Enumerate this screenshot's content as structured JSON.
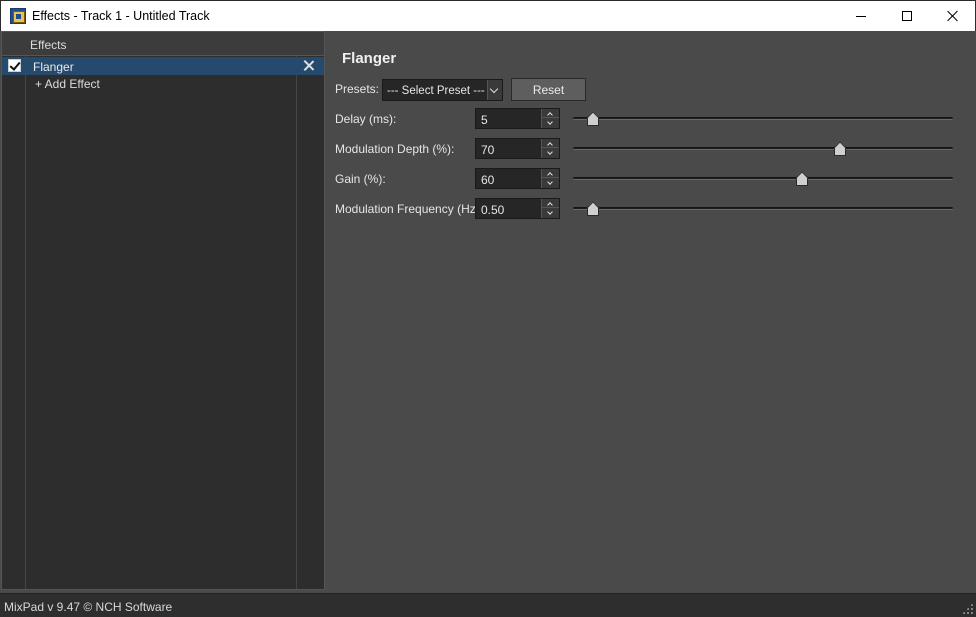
{
  "window": {
    "title": "Effects - Track 1 - Untitled Track"
  },
  "effects_panel": {
    "header": "Effects",
    "items": [
      {
        "label": "Flanger",
        "checked": true
      }
    ],
    "add_label": "+ Add Effect"
  },
  "effect": {
    "title": "Flanger",
    "presets_label": "Presets:",
    "preset_selected": "--- Select Preset ---",
    "reset_label": "Reset",
    "params": [
      {
        "label": "Delay (ms):",
        "value": "5",
        "slider_fraction": 0.05
      },
      {
        "label": "Modulation Depth (%):",
        "value": "70",
        "slider_fraction": 0.7
      },
      {
        "label": "Gain (%):",
        "value": "60",
        "slider_fraction": 0.6
      },
      {
        "label": "Modulation Frequency (Hz):",
        "value": "0.50",
        "slider_fraction": 0.05
      }
    ]
  },
  "status": {
    "text": "MixPad v 9.47 © NCH Software"
  }
}
